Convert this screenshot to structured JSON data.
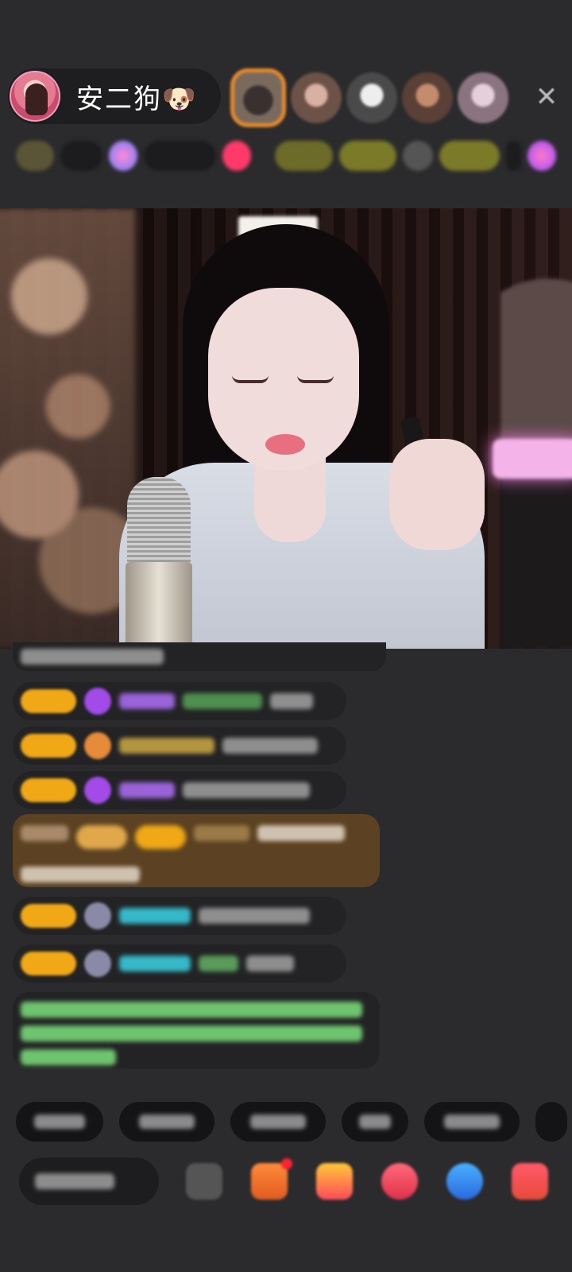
{
  "header": {
    "host_name": "安二狗🐶",
    "close_icon": "✕",
    "top_viewers": [
      {
        "color": "#6a5a52"
      },
      {
        "color": "#8a6c60"
      },
      {
        "color": "#9a8a88"
      },
      {
        "color": "#7a5a50"
      },
      {
        "color": "#b8a4b4"
      }
    ]
  },
  "colors": {
    "background": "#2b2b2d",
    "badge": "#f0a817",
    "special_message": "#5c4222",
    "system_message_text": "#6fc46f",
    "username_cyan": "#35b8c8",
    "username_purple": "#9a63d9"
  },
  "chat": [
    {
      "kind": "text"
    },
    {
      "kind": "user",
      "gem": "purple"
    },
    {
      "kind": "user",
      "gem": "orange"
    },
    {
      "kind": "user",
      "gem": "purple"
    },
    {
      "kind": "special"
    },
    {
      "kind": "user",
      "gem": "grey"
    },
    {
      "kind": "user",
      "gem": "grey"
    },
    {
      "kind": "system"
    }
  ],
  "bottom": {
    "tools": [
      "more-icon",
      "gift-box-icon",
      "gift-icon",
      "red-envelope-icon",
      "game-icon",
      "shop-icon"
    ]
  }
}
